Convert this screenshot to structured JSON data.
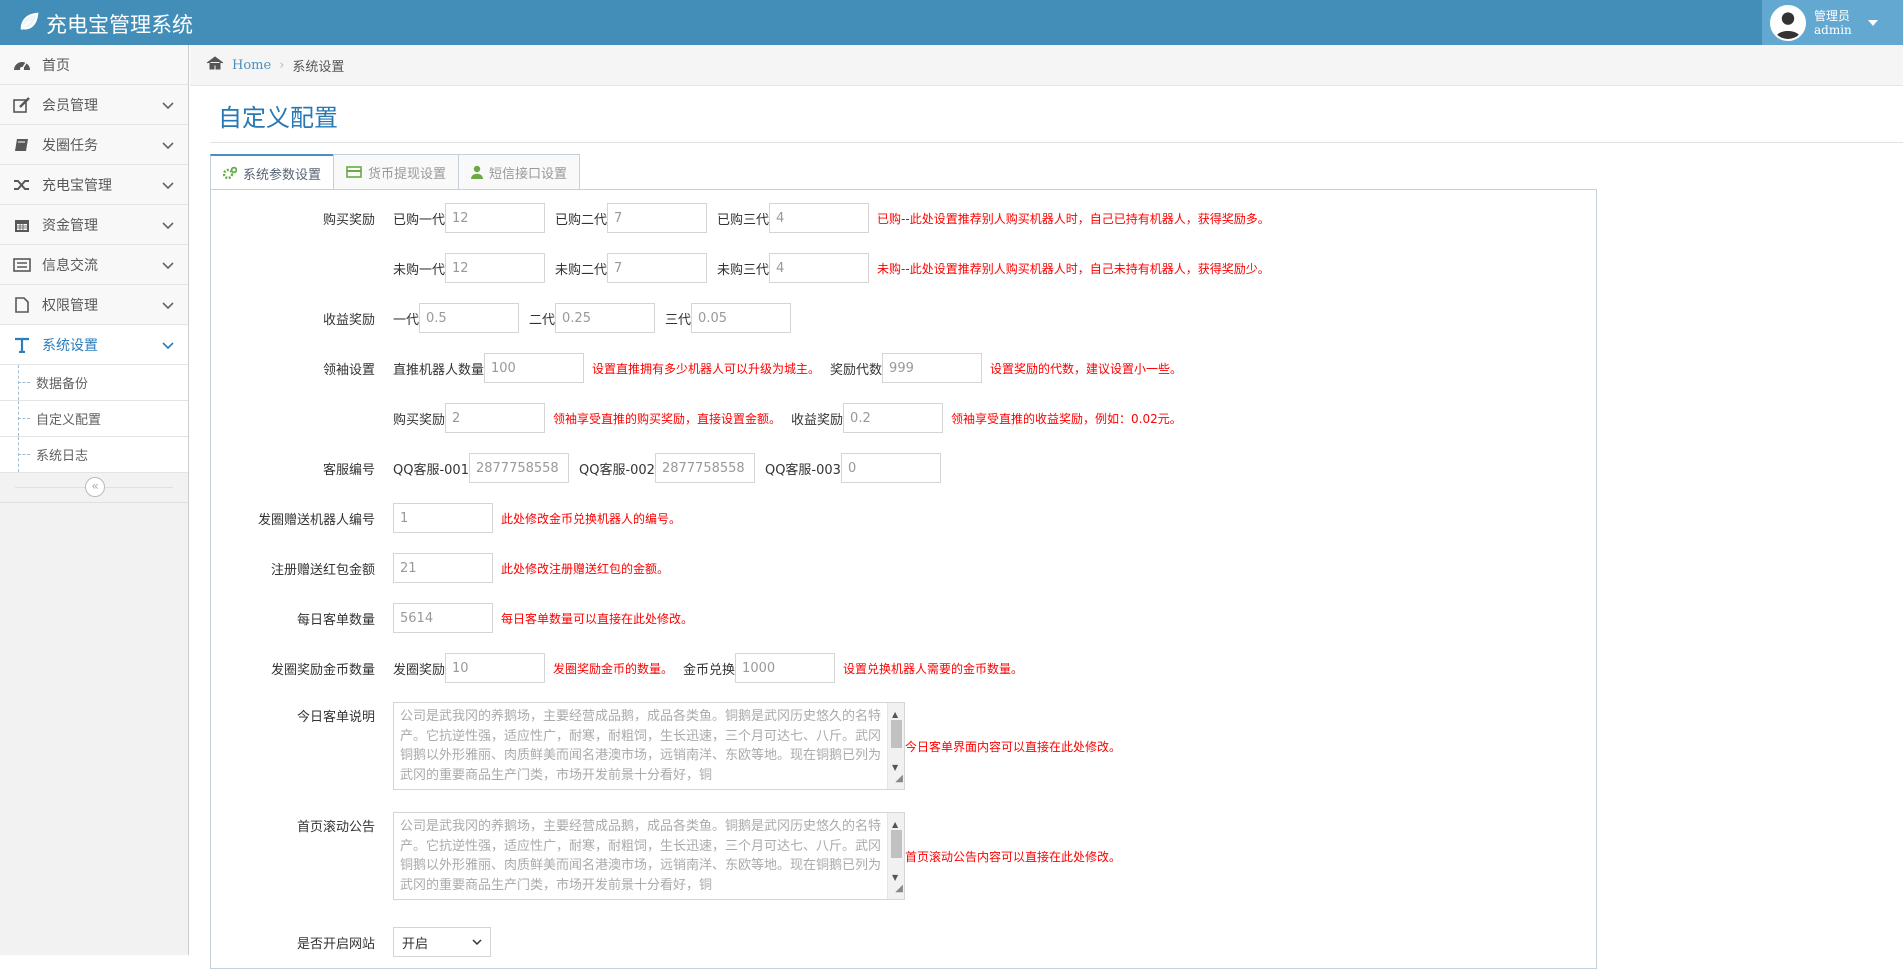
{
  "app": {
    "title": "充电宝管理系统"
  },
  "user": {
    "role": "管理员",
    "name": "admin"
  },
  "sidebar": {
    "items": [
      {
        "label": "首页",
        "icon": "dashboard-icon"
      },
      {
        "label": "会员管理",
        "icon": "edit-icon"
      },
      {
        "label": "发圈任务",
        "icon": "book-icon"
      },
      {
        "label": "充电宝管理",
        "icon": "shuffle-icon"
      },
      {
        "label": "资金管理",
        "icon": "calendar-icon"
      },
      {
        "label": "信息交流",
        "icon": "list-icon"
      },
      {
        "label": "权限管理",
        "icon": "file-icon"
      },
      {
        "label": "系统设置",
        "icon": "text-icon"
      }
    ],
    "sub_items": [
      {
        "label": "数据备份"
      },
      {
        "label": "自定义配置"
      },
      {
        "label": "系统日志"
      }
    ]
  },
  "breadcrumb": {
    "home": "Home",
    "current": "系统设置"
  },
  "page": {
    "title": "自定义配置"
  },
  "tabs": [
    {
      "label": "系统参数设置",
      "icon": "cogs-icon"
    },
    {
      "label": "货币提现设置",
      "icon": "credit-card-icon"
    },
    {
      "label": "短信接口设置",
      "icon": "user-icon"
    }
  ],
  "form": {
    "purchase": {
      "label": "购买奖励",
      "bought": {
        "l1": "已购一代",
        "v1": "12",
        "l2": "已购二代",
        "v2": "7",
        "l3": "已购三代",
        "v3": "4",
        "hint": "已购--此处设置推荐别人购买机器人时，自己已持有机器人，获得奖励多。"
      },
      "notbought": {
        "l1": "未购一代",
        "v1": "12",
        "l2": "未购二代",
        "v2": "7",
        "l3": "未购三代",
        "v3": "4",
        "hint": "未购--此处设置推荐别人购买机器人时，自己未持有机器人，获得奖励少。"
      }
    },
    "income": {
      "label": "收益奖励",
      "l1": "一代",
      "v1": "0.5",
      "l2": "二代",
      "v2": "0.25",
      "l3": "三代",
      "v3": "0.05"
    },
    "leader": {
      "label": "领袖设置",
      "direct_label": "直推机器人数量",
      "direct_value": "100",
      "direct_hint": "设置直推拥有多少机器人可以升级为城主。",
      "gen_label": "奖励代数",
      "gen_value": "999",
      "gen_hint": "设置奖励的代数，建议设置小一些。",
      "buy_label": "购买奖励",
      "buy_value": "2",
      "buy_hint": "领袖享受直推的购买奖励，直接设置金额。",
      "inc_label": "收益奖励",
      "inc_value": "0.2",
      "inc_hint": "领袖享受直推的收益奖励，例如：0.02元。"
    },
    "service": {
      "label": "客服编号",
      "l1": "QQ客服-001",
      "v1": "2877758558",
      "l2": "QQ客服-002",
      "v2": "2877758558",
      "l3": "QQ客服-003",
      "v3": "0"
    },
    "robot": {
      "label": "发圈赠送机器人编号",
      "value": "1",
      "hint": "此处修改金币兑换机器人的编号。"
    },
    "redpack": {
      "label": "注册赠送红包金额",
      "value": "21",
      "hint": "此处修改注册赠送红包的金额。"
    },
    "daily": {
      "label": "每日客单数量",
      "value": "5614",
      "hint": "每日客单数量可以直接在此处修改。"
    },
    "coins": {
      "label": "发圈奖励金币数量",
      "l1": "发圈奖励",
      "v1": "10",
      "hint1": "发圈奖励金币的数量。",
      "l2": "金币兑换",
      "v2": "1000",
      "hint2": "设置兑换机器人需要的金币数量。"
    },
    "today_desc": {
      "label": "今日客单说明",
      "text": "公司是武我冈的养鹅场，主要经营成品鹅，成品各类鱼。铜鹅是武冈历史悠久的名特产。它抗逆性强，适应性广，耐寒，耐粗饲，生长迅速，三个月可达七、八斤。武冈铜鹅以外形雅丽、肉质鲜美而闻名港澳市场，远销南洋、东欧等地。现在铜鹅已列为武冈的重要商品生产门类，市场开发前景十分看好，铜",
      "hint": "今日客单界面内容可以直接在此处修改。"
    },
    "notice": {
      "label": "首页滚动公告",
      "text": "公司是武我冈的养鹅场，主要经营成品鹅，成品各类鱼。铜鹅是武冈历史悠久的名特产。它抗逆性强，适应性广，耐寒，耐粗饲，生长迅速，三个月可达七、八斤。武冈铜鹅以外形雅丽、肉质鲜美而闻名港澳市场，远销南洋、东欧等地。现在铜鹅已列为武冈的重要商品生产门类，市场开发前景十分看好，铜",
      "hint": "首页滚动公告内容可以直接在此处修改。"
    },
    "site_open": {
      "label": "是否开启网站",
      "value": "开启"
    }
  },
  "colors": {
    "topbar": "#438eb9",
    "accent": "#2679b5",
    "hint": "#ff0000"
  }
}
